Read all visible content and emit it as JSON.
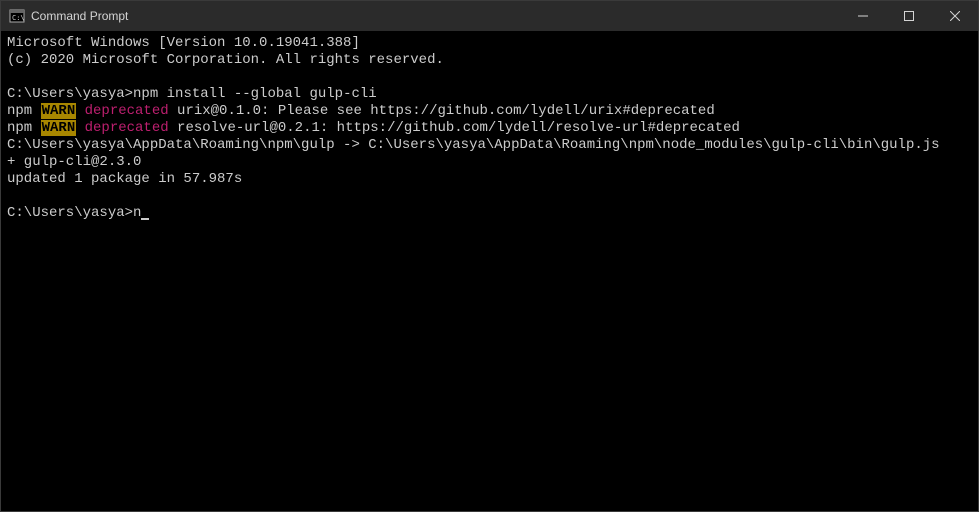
{
  "window": {
    "title": "Command Prompt"
  },
  "terminal": {
    "header_line1": "Microsoft Windows [Version 10.0.19041.388]",
    "header_line2": "(c) 2020 Microsoft Corporation. All rights reserved.",
    "prompt1_path": "C:\\Users\\yasya>",
    "prompt1_cmd": "npm install --global gulp-cli",
    "npm_label": "npm ",
    "warn_label": "WARN",
    "deprecated_label": " deprecated",
    "warn1_msg": " urix@0.1.0: Please see https://github.com/lydell/urix#deprecated",
    "warn2_msg": " resolve-url@0.2.1: https://github.com/lydell/resolve-url#deprecated",
    "link_line": "C:\\Users\\yasya\\AppData\\Roaming\\npm\\gulp -> C:\\Users\\yasya\\AppData\\Roaming\\npm\\node_modules\\gulp-cli\\bin\\gulp.js",
    "result_line": "+ gulp-cli@2.3.0",
    "updated_line": "updated 1 package in 57.987s",
    "prompt2_path": "C:\\Users\\yasya>",
    "prompt2_input": "n"
  }
}
